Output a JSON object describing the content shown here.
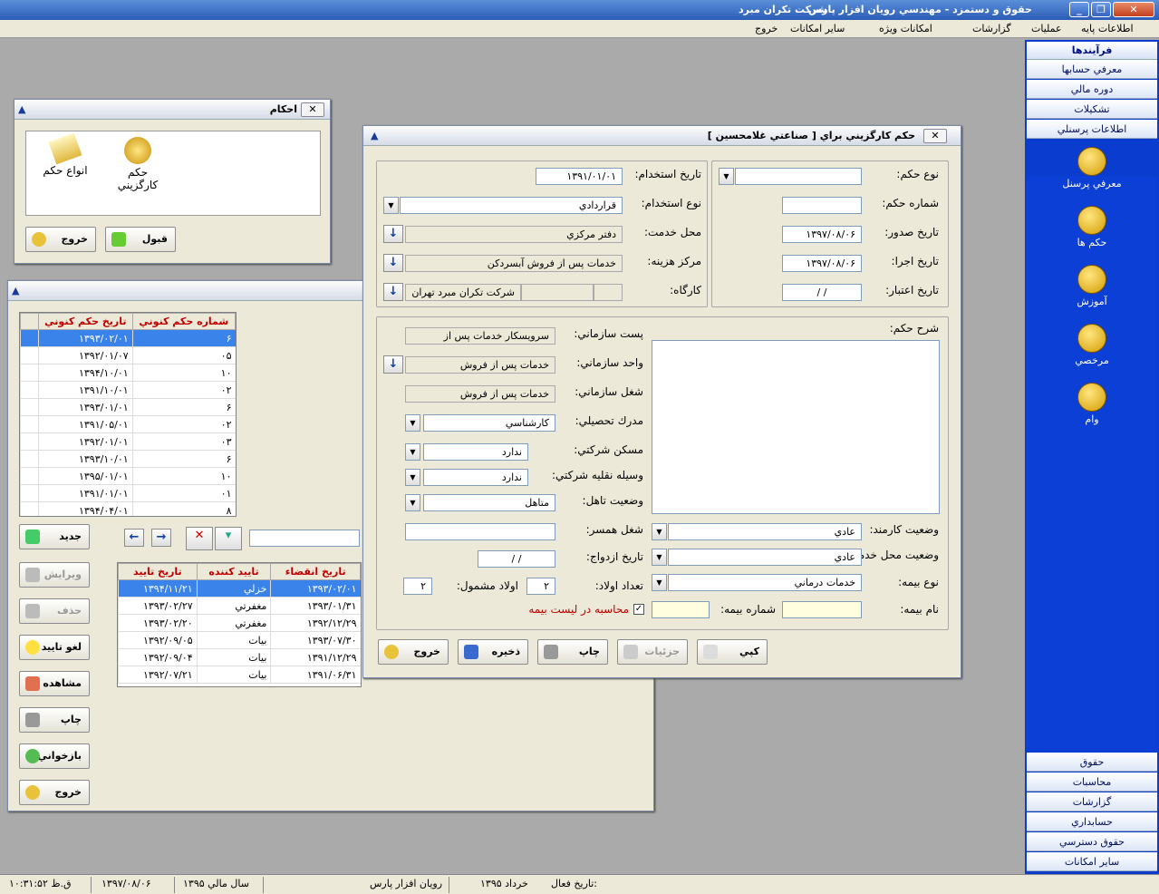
{
  "app": {
    "title": "حقوق و دستمزد - مهندسي رويان افزار پارس",
    "company": "شركت تكران مبرد"
  },
  "menu": [
    "اطلاعات پايه",
    "عمليات",
    "گزارشات",
    "امكانات ويژه",
    "ساير امكانات",
    "خروج"
  ],
  "right_panel": {
    "header": "فرآيندها",
    "top_items": [
      "معرفي حسابها",
      "دوره مالي",
      "تشكيلات",
      "اطلاعات پرسنلي"
    ],
    "icons": [
      "معرفي پرسنل",
      "حكم ها",
      "آموزش",
      "مرخصي",
      "وام"
    ],
    "bottom_items": [
      "حقوق",
      "محاسبات",
      "گزارشات",
      "حسابداري",
      "حقوق دسترسي",
      "ساير امكانات"
    ]
  },
  "ahkam_window": {
    "title": "احكام",
    "icon1": "حكم كارگزيني",
    "icon2": "انواع حكم",
    "ok": "قبول",
    "exit": "خروج"
  },
  "list_window": {
    "grid1": {
      "headers": [
        "تاريخ حكم كنوني",
        "شماره حكم كنوني"
      ],
      "rows": [
        [
          "۱۳۹۳/۰۲/۰۱",
          "۶"
        ],
        [
          "۱۳۹۲/۰۱/۰۷",
          "۰۵"
        ],
        [
          "۱۳۹۴/۱۰/۰۱",
          "۱۰"
        ],
        [
          "۱۳۹۱/۱۰/۰۱",
          "۰۲"
        ],
        [
          "۱۳۹۳/۰۱/۰۱",
          "۶"
        ],
        [
          "۱۳۹۱/۰۵/۰۱",
          "۰۲"
        ],
        [
          "۱۳۹۲/۰۱/۰۱",
          "۰۳"
        ],
        [
          "۱۳۹۳/۱۰/۰۱",
          "۶"
        ],
        [
          "۱۳۹۵/۰۱/۰۱",
          "۱۰"
        ],
        [
          "۱۳۹۱/۰۱/۰۱",
          "۰۱"
        ],
        [
          "۱۳۹۴/۰۴/۰۱",
          "۸"
        ]
      ]
    },
    "grid2": {
      "headers": [
        "تاريخ انقضاء",
        "تاييد كننده",
        "تاريخ تاييد"
      ],
      "rows": [
        [
          "۱۳۹۳/۰۲/۰۱",
          "خزلي",
          "۱۳۹۴/۱۱/۲۱"
        ],
        [
          "۱۳۹۳/۰۱/۳۱",
          "مغفرتي",
          "۱۳۹۳/۰۲/۲۷"
        ],
        [
          "۱۳۹۲/۱۲/۲۹",
          "مغفرتي",
          "۱۳۹۳/۰۲/۲۰"
        ],
        [
          "۱۳۹۳/۰۷/۳۰",
          "بيات",
          "۱۳۹۲/۰۹/۰۵"
        ],
        [
          "۱۳۹۱/۱۲/۲۹",
          "بيات",
          "۱۳۹۲/۰۹/۰۴"
        ],
        [
          "۱۳۹۱/۰۶/۳۱",
          "بيات",
          "۱۳۹۲/۰۷/۲۱"
        ]
      ]
    },
    "buttons": [
      "جديد",
      "ويرايش",
      "حذف",
      "لغو تاييد",
      "مشاهده",
      "چاپ",
      "بازخواني",
      "خروج"
    ]
  },
  "hokm": {
    "title": "حكم كارگزيني براي [ صناعتي غلامحسين ]",
    "labels": {
      "type": "نوع حكم:",
      "number": "شماره حكم:",
      "issue": "تاريخ صدور:",
      "exec": "تاريخ اجرا:",
      "valid": "تاريخ اعتبار:",
      "hire_date": "تاريخ استخدام:",
      "hire_type": "نوع استخدام:",
      "place": "محل خدمت:",
      "cost": "مركز هزينه:",
      "workshop": "كارگاه:",
      "post": "پست سازماني:",
      "unit": "واحد سازماني:",
      "job": "شغل سازماني:",
      "edu": "مدرك تحصيلي:",
      "house": "مسكن شركتي:",
      "vehicle": "وسيله نقليه شركتي:",
      "marital": "وضعيت تاهل:",
      "spouse_job": "شغل همسر:",
      "marriage_date": "تاريخ ازدواج:",
      "children": "تعداد اولاد:",
      "children_inc": "اولاد مشمول:",
      "desc": "شرح حكم:",
      "emp_status": "وضعيت كارمند:",
      "place_status": "وضعيت محل خدمت:",
      "ins_type": "نوع بيمه:",
      "ins_name": "نام بيمه:",
      "ins_no": "شماره بيمه:",
      "calc_ins": "محاسبه در ليست بيمه"
    },
    "values": {
      "issue": "۱۳۹۷/۰۸/۰۶",
      "exec": "۱۳۹۷/۰۸/۰۶",
      "valid": "/    /",
      "hire_date": "۱۳۹۱/۰۱/۰۱",
      "hire_type": "قراردادي",
      "place": "دفتر مركزي",
      "cost": "خدمات پس از فروش آبسردكن",
      "workshop": "شركت تكران مبرد تهران",
      "post": "سرويسكار خدمات پس از",
      "unit": "خدمات پس از فروش",
      "job": "خدمات پس از فروش",
      "edu": "كارشناسي",
      "house": "ندارد",
      "vehicle": "ندارد",
      "marital": "متاهل",
      "marriage_date": "/    /",
      "children": "۲",
      "children_inc": "۲",
      "emp_status": "عادي",
      "place_status": "عادي",
      "ins_type": "خدمات درماني"
    },
    "buttons": {
      "copy": "كپي",
      "details": "جزئيات",
      "print": "چاپ",
      "save": "ذخيره",
      "exit": "خروج"
    }
  },
  "status": {
    "date_label": "تاريخ فعال:",
    "date_val": "خرداد ۱۳۹۵",
    "company": "رويان افزار پارس",
    "fy": "سال مالي ۱۳۹۵",
    "today": "۱۳۹۷/۰۸/۰۶",
    "time": "ق.ظ ۱۰:۳۱:۵۲"
  }
}
